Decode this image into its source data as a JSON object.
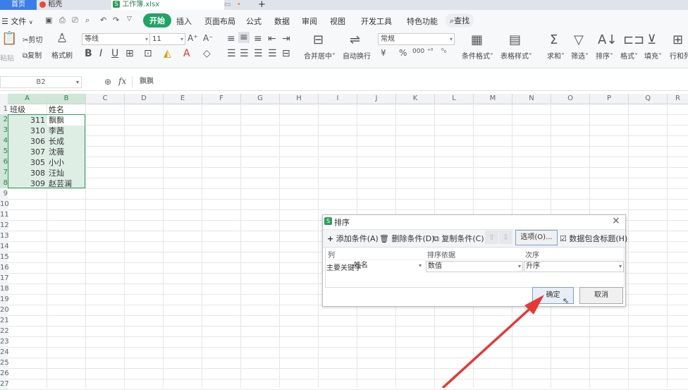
{
  "titlebar": {
    "tab_home": "首页",
    "tab_docer": "稻壳",
    "tab_file": "工作簿.xlsx",
    "new_tab": "+",
    "file_badge": "S"
  },
  "menubar": {
    "file_menu": "文件",
    "tabs": [
      "开始",
      "插入",
      "页面布局",
      "公式",
      "数据",
      "审阅",
      "视图",
      "开发工具",
      "特色功能"
    ],
    "search": "查找"
  },
  "ribbon": {
    "cut": "剪切",
    "paste": "粘贴",
    "copy": "复制",
    "format_painter": "格式刷",
    "font_name": "等线",
    "font_size": "11",
    "merge_center": "合并居中",
    "wrap_text": "自动换行",
    "number_format": "常规",
    "conditional_format": "条件格式",
    "table_style": "表格样式",
    "sum": "求和",
    "filter": "筛选",
    "sort": "排序",
    "format": "格式",
    "fill": "填充",
    "row_col": "行和列",
    "currency_symbol": "¥",
    "percent_symbol": "%",
    "thousands_symbol": "000"
  },
  "formula_bar": {
    "name_box": "B2",
    "fx": "fx",
    "value": "飘飘"
  },
  "grid": {
    "columns": [
      "A",
      "B",
      "C",
      "D",
      "E",
      "F",
      "G",
      "H",
      "I",
      "J",
      "K",
      "L",
      "M",
      "N",
      "O",
      "P",
      "Q",
      "R"
    ],
    "row_numbers": [
      "1",
      "2",
      "3",
      "4",
      "5",
      "6",
      "7",
      "8",
      "9",
      "10",
      "11",
      "12",
      "13",
      "14",
      "15",
      "16",
      "17",
      "18",
      "19",
      "20",
      "21",
      "22",
      "23",
      "24",
      "25",
      "26",
      "27"
    ],
    "header": [
      "班级",
      "姓名"
    ],
    "rows": [
      [
        "311",
        "飘飘"
      ],
      [
        "310",
        "李茜"
      ],
      [
        "306",
        "长成"
      ],
      [
        "307",
        "沈薇"
      ],
      [
        "305",
        "小小"
      ],
      [
        "308",
        "汪灿"
      ],
      [
        "309",
        "赵芸澜"
      ]
    ]
  },
  "dialog": {
    "title": "排序",
    "add_condition": "添加条件(A)",
    "delete_condition": "删除条件(D)",
    "copy_condition": "复制条件(C)",
    "options": "选项(O)...",
    "has_header": "数据包含标题(H)",
    "col_header": "列",
    "sort_on_header": "排序依据",
    "order_header": "次序",
    "primary_key_label": "主要关键字",
    "primary_key_value": "姓名",
    "sort_on_value": "数值",
    "order_value": "升序",
    "ok": "确定",
    "cancel": "取消",
    "close": "×"
  },
  "colors": {
    "accent_green": "#21a366",
    "selection_green": "#cfe6d8",
    "arrow_red": "#e53935"
  }
}
